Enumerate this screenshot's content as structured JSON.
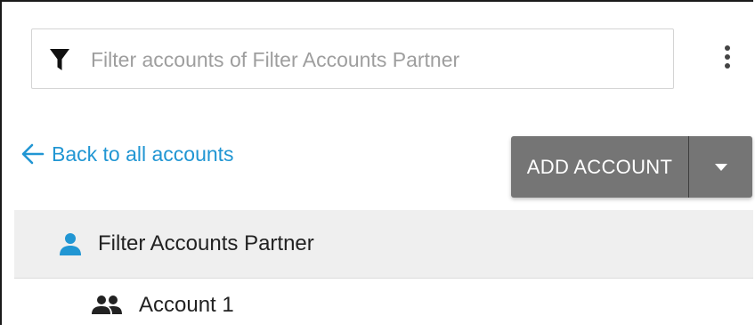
{
  "filter": {
    "placeholder": "Filter accounts of Filter Accounts Partner",
    "value": "",
    "icon": "filter-icon"
  },
  "menu": {
    "icon": "more-vert-icon"
  },
  "back_link": {
    "label": "Back to all accounts",
    "icon": "arrow-left-icon",
    "color": "#2196d3"
  },
  "add_account": {
    "label": "ADD ACCOUNT",
    "dropdown_icon": "caret-down-icon",
    "background": "#757575"
  },
  "tree": {
    "partner": {
      "label": "Filter Accounts Partner",
      "icon": "person-icon",
      "icon_color": "#2196d3"
    },
    "accounts": [
      {
        "label": "Account 1",
        "icon": "group-icon"
      }
    ]
  }
}
